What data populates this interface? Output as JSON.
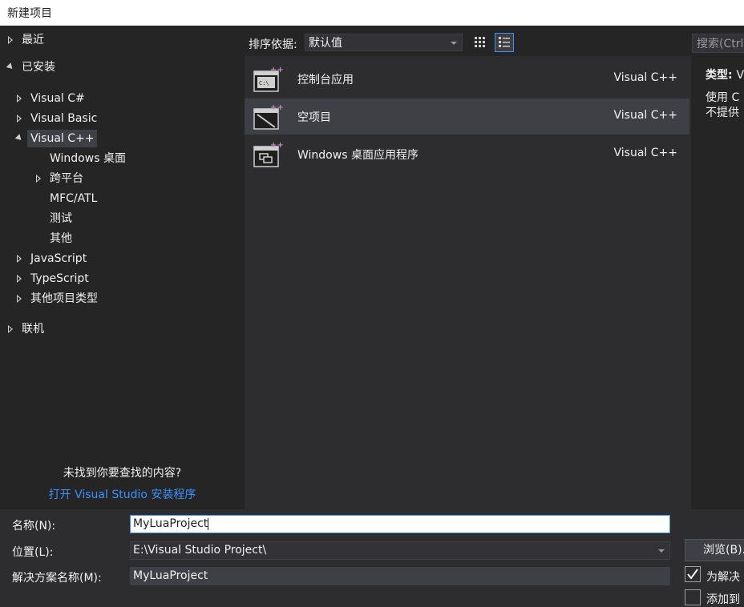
{
  "window": {
    "title": "新建项目"
  },
  "tree": {
    "recent": "最近",
    "installed": "已安装",
    "visual_csharp": "Visual C#",
    "visual_basic": "Visual Basic",
    "visual_cpp": "Visual C++",
    "windows_desktop": "Windows 桌面",
    "cross_platform": "跨平台",
    "mfc_atl": "MFC/ATL",
    "test": "测试",
    "other": "其他",
    "javascript": "JavaScript",
    "typescript": "TypeScript",
    "other_project_types": "其他项目类型",
    "online": "联机"
  },
  "not_found": {
    "text": "未找到你要查找的内容?",
    "link": "打开 Visual Studio 安装程序"
  },
  "sort": {
    "label": "排序依据:",
    "value": "默认值"
  },
  "templates": [
    {
      "name": "控制台应用",
      "lang": "Visual C++",
      "icon": "console-app-icon"
    },
    {
      "name": "空项目",
      "lang": "Visual C++",
      "icon": "empty-project-icon"
    },
    {
      "name": "Windows 桌面应用程序",
      "lang": "Visual C++",
      "icon": "windows-desktop-app-icon"
    }
  ],
  "search": {
    "placeholder": "搜索(Ctrl"
  },
  "details": {
    "type_label": "类型:",
    "type_value": "V",
    "desc_line1": "使用 C",
    "desc_line2": "不提供"
  },
  "form": {
    "name_label": "名称(N):",
    "name_value": "MyLuaProject",
    "location_label": "位置(L):",
    "location_value": "E:\\Visual Studio Project\\",
    "solution_label": "解决方案名称(M):",
    "solution_value": "MyLuaProject",
    "browse_label": "浏览(B)...",
    "create_dir_label": "为解决",
    "add_to_source_label": "添加到"
  },
  "colors": {
    "accent": "#3794ff",
    "background": "#252526",
    "list_bg": "#2d2d30",
    "selected": "#3f3f46",
    "icon_plus": "#c586c0"
  }
}
